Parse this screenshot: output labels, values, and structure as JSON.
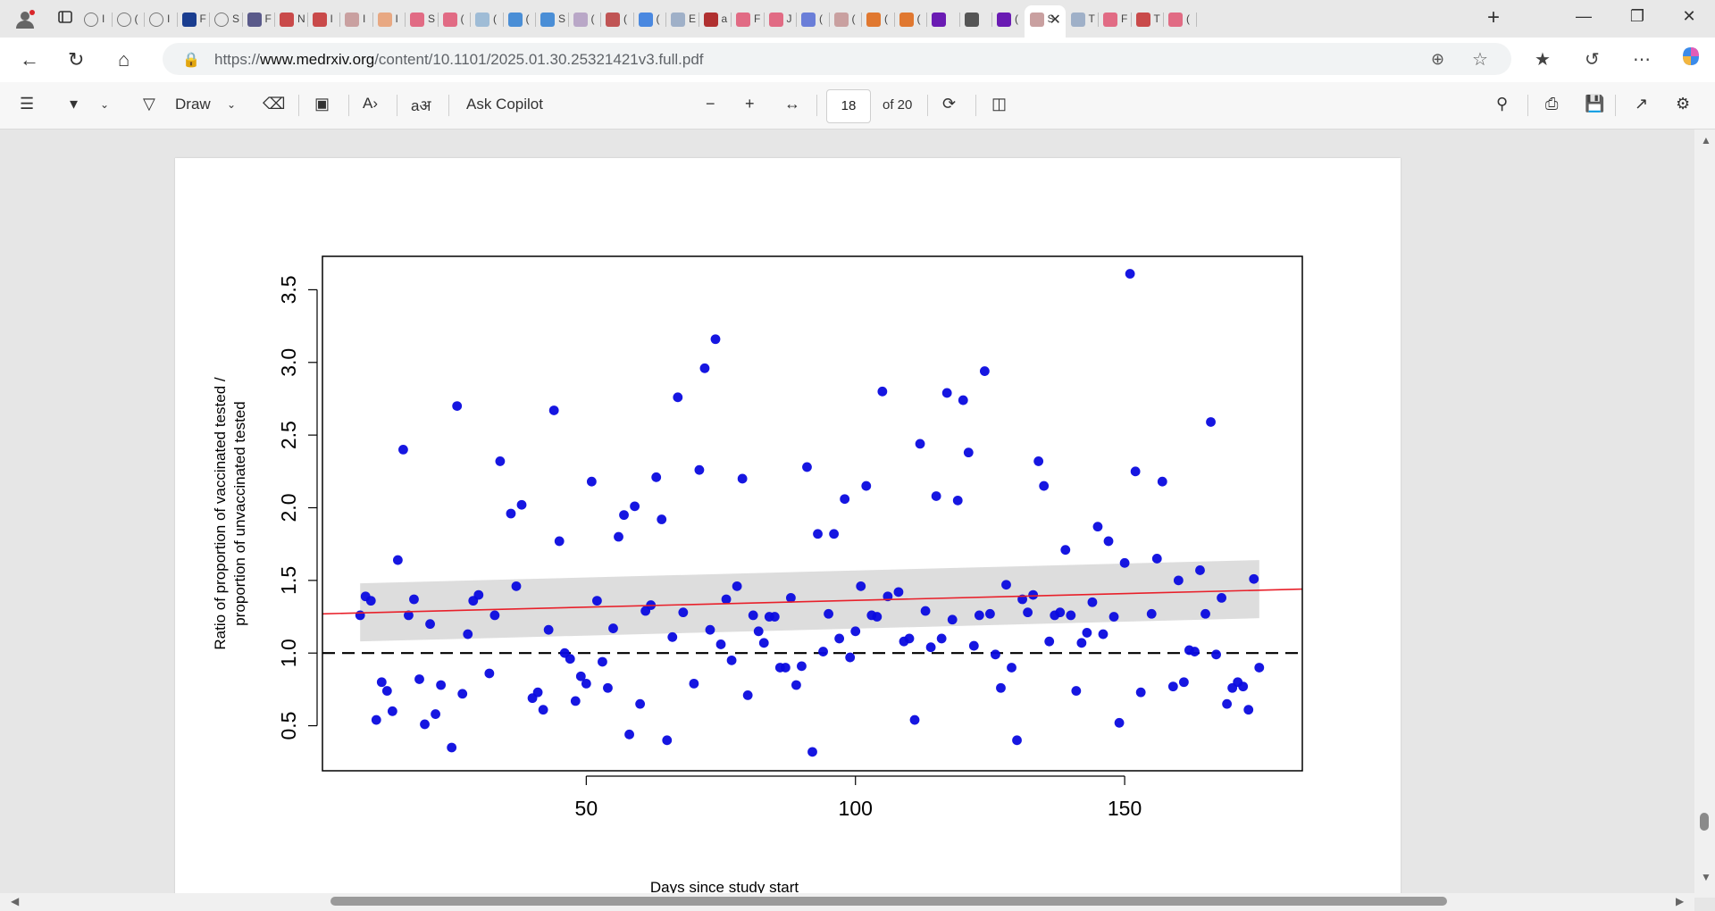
{
  "browser": {
    "tabs": [
      {
        "icon": "globe-icon",
        "label": "I"
      },
      {
        "icon": "globe-icon",
        "label": "("
      },
      {
        "icon": "globe-icon",
        "label": "I"
      },
      {
        "icon": "fox-news-icon",
        "label": "F"
      },
      {
        "icon": "globe-icon",
        "label": "S"
      },
      {
        "icon": "arrow-icon",
        "label": "F"
      },
      {
        "icon": "r-icon",
        "label": "N"
      },
      {
        "icon": "r-icon",
        "label": "I"
      },
      {
        "icon": "pdf-icon",
        "label": "I"
      },
      {
        "icon": "circle-icon",
        "label": "I"
      },
      {
        "icon": "youtube-icon",
        "label": "S"
      },
      {
        "icon": "youtube-icon",
        "label": "("
      },
      {
        "icon": "heart-icon",
        "label": "("
      },
      {
        "icon": "c-icon",
        "label": "("
      },
      {
        "icon": "c-icon",
        "label": "S"
      },
      {
        "icon": "dotted-icon",
        "label": "("
      },
      {
        "icon": "s-icon",
        "label": "("
      },
      {
        "icon": "google-icon",
        "label": "("
      },
      {
        "icon": "gp-icon",
        "label": "E"
      },
      {
        "icon": "feather-icon",
        "label": "a"
      },
      {
        "icon": "youtube-icon",
        "label": "F"
      },
      {
        "icon": "youtube-icon",
        "label": "J"
      },
      {
        "icon": "wiki-icon",
        "label": "("
      },
      {
        "icon": "pdf-icon",
        "label": "("
      },
      {
        "icon": "bookmark-icon",
        "label": "("
      },
      {
        "icon": "bookmark-icon",
        "label": "("
      },
      {
        "icon": "yahoo-icon",
        "label": ""
      },
      {
        "icon": "ai-icon",
        "label": ""
      },
      {
        "icon": "mail-icon",
        "label": "("
      },
      {
        "icon": "pdf-icon",
        "label": "S",
        "active": true
      },
      {
        "icon": "gp-icon",
        "label": "T"
      },
      {
        "icon": "youtube-icon",
        "label": "F"
      },
      {
        "icon": "r-icon",
        "label": "T"
      },
      {
        "icon": "youtube-icon",
        "label": "("
      }
    ],
    "url_prefix": "https://",
    "url_domain": "www.medrxiv.org",
    "url_path": "/content/10.1101/2025.01.30.25321421v3.full.pdf"
  },
  "pdf_toolbar": {
    "draw_label": "Draw",
    "ask_copilot_label": "Ask Copilot",
    "page_number": "18",
    "page_total": "of 20"
  },
  "chart_data": {
    "type": "scatter",
    "xlabel": "Days since study start",
    "ylabel_line1": "Ratio of proportion of vaccinated tested /",
    "ylabel_line2": "proportion of unvaccinated tested",
    "xlim": [
      1,
      183
    ],
    "ylim": [
      0.19,
      3.73
    ],
    "x_ticks": [
      50,
      100,
      150
    ],
    "x_tick_labels": [
      "50",
      "100",
      "150"
    ],
    "y_ticks": [
      0.5,
      1.0,
      1.5,
      2.0,
      2.5,
      3.0,
      3.5
    ],
    "y_tick_labels": [
      "0.5",
      "1.0",
      "1.5",
      "2.0",
      "2.5",
      "3.0",
      "3.5"
    ],
    "reference_line_y": 1.0,
    "trend_line": {
      "x": [
        1,
        183
      ],
      "y": [
        1.27,
        1.44
      ],
      "color": "#e8202a"
    },
    "confidence_band": {
      "x": [
        8,
        175
      ],
      "lower": [
        1.08,
        1.24
      ],
      "upper": [
        1.48,
        1.64
      ],
      "color": "#d9d9d9"
    },
    "point_color": "#0a0adf",
    "points": [
      [
        8,
        1.26
      ],
      [
        9,
        1.39
      ],
      [
        10,
        1.36
      ],
      [
        11,
        0.54
      ],
      [
        12,
        0.8
      ],
      [
        13,
        0.74
      ],
      [
        14,
        0.6
      ],
      [
        15,
        1.64
      ],
      [
        16,
        2.4
      ],
      [
        17,
        1.26
      ],
      [
        18,
        1.37
      ],
      [
        19,
        0.82
      ],
      [
        20,
        0.51
      ],
      [
        21,
        1.2
      ],
      [
        22,
        0.58
      ],
      [
        23,
        0.78
      ],
      [
        25,
        0.35
      ],
      [
        26,
        2.7
      ],
      [
        27,
        0.72
      ],
      [
        28,
        1.13
      ],
      [
        29,
        1.36
      ],
      [
        30,
        1.4
      ],
      [
        32,
        0.86
      ],
      [
        33,
        1.26
      ],
      [
        34,
        2.32
      ],
      [
        36,
        1.96
      ],
      [
        37,
        1.46
      ],
      [
        38,
        2.02
      ],
      [
        40,
        0.69
      ],
      [
        41,
        0.73
      ],
      [
        42,
        0.61
      ],
      [
        43,
        1.16
      ],
      [
        44,
        2.67
      ],
      [
        45,
        1.77
      ],
      [
        46,
        1.0
      ],
      [
        47,
        0.96
      ],
      [
        48,
        0.67
      ],
      [
        49,
        0.84
      ],
      [
        50,
        0.79
      ],
      [
        51,
        2.18
      ],
      [
        52,
        1.36
      ],
      [
        53,
        0.94
      ],
      [
        54,
        0.76
      ],
      [
        55,
        1.17
      ],
      [
        56,
        1.8
      ],
      [
        57,
        1.95
      ],
      [
        58,
        0.44
      ],
      [
        59,
        2.01
      ],
      [
        60,
        0.65
      ],
      [
        61,
        1.29
      ],
      [
        62,
        1.33
      ],
      [
        63,
        2.21
      ],
      [
        64,
        1.92
      ],
      [
        65,
        0.4
      ],
      [
        66,
        1.11
      ],
      [
        67,
        2.76
      ],
      [
        68,
        1.28
      ],
      [
        70,
        0.79
      ],
      [
        71,
        2.26
      ],
      [
        72,
        2.96
      ],
      [
        73,
        1.16
      ],
      [
        74,
        3.16
      ],
      [
        75,
        1.06
      ],
      [
        76,
        1.37
      ],
      [
        77,
        0.95
      ],
      [
        78,
        1.46
      ],
      [
        79,
        2.2
      ],
      [
        80,
        0.71
      ],
      [
        81,
        1.26
      ],
      [
        82,
        1.15
      ],
      [
        83,
        1.07
      ],
      [
        84,
        1.25
      ],
      [
        85,
        1.25
      ],
      [
        86,
        0.9
      ],
      [
        87,
        0.9
      ],
      [
        88,
        1.38
      ],
      [
        89,
        0.78
      ],
      [
        90,
        0.91
      ],
      [
        91,
        2.28
      ],
      [
        92,
        0.32
      ],
      [
        93,
        1.82
      ],
      [
        94,
        1.01
      ],
      [
        95,
        1.27
      ],
      [
        96,
        1.82
      ],
      [
        97,
        1.1
      ],
      [
        98,
        2.06
      ],
      [
        99,
        0.97
      ],
      [
        100,
        1.15
      ],
      [
        101,
        1.46
      ],
      [
        102,
        2.15
      ],
      [
        103,
        1.26
      ],
      [
        104,
        1.25
      ],
      [
        105,
        2.8
      ],
      [
        106,
        1.39
      ],
      [
        108,
        1.42
      ],
      [
        109,
        1.08
      ],
      [
        110,
        1.1
      ],
      [
        111,
        0.54
      ],
      [
        112,
        2.44
      ],
      [
        113,
        1.29
      ],
      [
        114,
        1.04
      ],
      [
        115,
        2.08
      ],
      [
        116,
        1.1
      ],
      [
        117,
        2.79
      ],
      [
        118,
        1.23
      ],
      [
        119,
        2.05
      ],
      [
        120,
        2.74
      ],
      [
        121,
        2.38
      ],
      [
        122,
        1.05
      ],
      [
        123,
        1.26
      ],
      [
        124,
        2.94
      ],
      [
        125,
        1.27
      ],
      [
        126,
        0.99
      ],
      [
        127,
        0.76
      ],
      [
        128,
        1.47
      ],
      [
        129,
        0.9
      ],
      [
        130,
        0.4
      ],
      [
        131,
        1.37
      ],
      [
        132,
        1.28
      ],
      [
        133,
        1.4
      ],
      [
        134,
        2.32
      ],
      [
        135,
        2.15
      ],
      [
        136,
        1.08
      ],
      [
        137,
        1.26
      ],
      [
        138,
        1.28
      ],
      [
        139,
        1.71
      ],
      [
        140,
        1.26
      ],
      [
        141,
        0.74
      ],
      [
        142,
        1.07
      ],
      [
        143,
        1.14
      ],
      [
        144,
        1.35
      ],
      [
        145,
        1.87
      ],
      [
        146,
        1.13
      ],
      [
        147,
        1.77
      ],
      [
        148,
        1.25
      ],
      [
        149,
        0.52
      ],
      [
        150,
        1.62
      ],
      [
        151,
        3.61
      ],
      [
        152,
        2.25
      ],
      [
        153,
        0.73
      ],
      [
        155,
        1.27
      ],
      [
        156,
        1.65
      ],
      [
        157,
        2.18
      ],
      [
        159,
        0.77
      ],
      [
        160,
        1.5
      ],
      [
        161,
        0.8
      ],
      [
        162,
        1.02
      ],
      [
        163,
        1.01
      ],
      [
        164,
        1.57
      ],
      [
        165,
        1.27
      ],
      [
        166,
        2.59
      ],
      [
        167,
        0.99
      ],
      [
        168,
        1.38
      ],
      [
        169,
        0.65
      ],
      [
        170,
        0.76
      ],
      [
        171,
        0.8
      ],
      [
        172,
        0.77
      ],
      [
        173,
        0.61
      ],
      [
        174,
        1.51
      ],
      [
        175,
        0.9
      ]
    ]
  }
}
